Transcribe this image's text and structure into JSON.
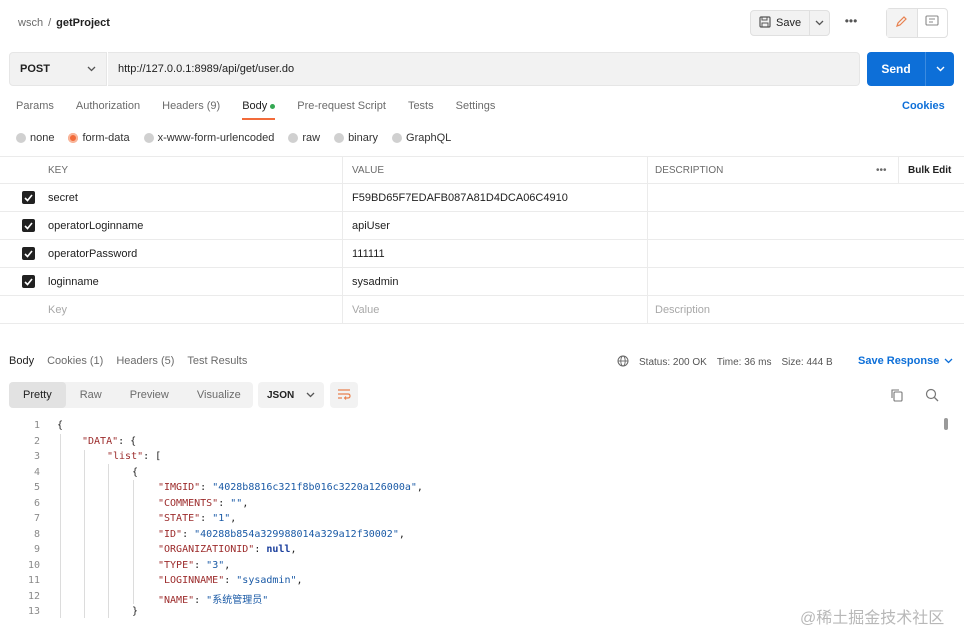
{
  "breadcrumb": {
    "workspace": "wsch",
    "separator": "/",
    "request": "getProject"
  },
  "toolbar": {
    "save_label": "Save",
    "more": "•••"
  },
  "request": {
    "method": "POST",
    "url": "http://127.0.0.1:8989/api/get/user.do",
    "send_label": "Send"
  },
  "tabs": {
    "params": "Params",
    "authorization": "Authorization",
    "headers": "Headers (9)",
    "body": "Body",
    "prerequest": "Pre-request Script",
    "tests": "Tests",
    "settings": "Settings",
    "cookies": "Cookies"
  },
  "body_types": {
    "none": "none",
    "form_data": "form-data",
    "urlencoded": "x-www-form-urlencoded",
    "raw": "raw",
    "binary": "binary",
    "graphql": "GraphQL"
  },
  "kv_table": {
    "headers": {
      "key": "KEY",
      "value": "VALUE",
      "description": "DESCRIPTION",
      "more": "•••",
      "bulk_edit": "Bulk Edit"
    },
    "rows": [
      {
        "key": "secret",
        "value": "F59BD65F7EDAFB087A81D4DCA06C4910"
      },
      {
        "key": "operatorLoginname",
        "value": "apiUser"
      },
      {
        "key": "operatorPassword",
        "value": "111111"
      },
      {
        "key": "loginname",
        "value": "sysadmin"
      }
    ],
    "placeholders": {
      "key": "Key",
      "value": "Value",
      "description": "Description"
    }
  },
  "response": {
    "tabs": {
      "body": "Body",
      "cookies": "Cookies (1)",
      "headers": "Headers (5)",
      "test_results": "Test Results"
    },
    "status": "Status: 200 OK",
    "time": "Time: 36 ms",
    "size": "Size: 444 B",
    "save_response": "Save Response",
    "views": {
      "pretty": "Pretty",
      "raw": "Raw",
      "preview": "Preview",
      "visualize": "Visualize"
    },
    "format": "JSON"
  },
  "code": {
    "line_numbers": [
      "1",
      "2",
      "3",
      "4",
      "5",
      "6",
      "7",
      "8",
      "9",
      "10",
      "11",
      "12",
      "13"
    ],
    "l1": "{",
    "l2_key": "\"DATA\"",
    "l2_rest": ": {",
    "l3_key": "\"list\"",
    "l3_rest": ": [",
    "l4": "{",
    "l5_key": "\"IMGID\"",
    "l5_val": "\"4028b8816c321f8b016c3220a126000a\"",
    "l6_key": "\"COMMENTS\"",
    "l6_val": "\"\"",
    "l7_key": "\"STATE\"",
    "l7_val": "\"1\"",
    "l8_key": "\"ID\"",
    "l8_val": "\"40288b854a329988014a329a12f30002\"",
    "l9_key": "\"ORGANIZATIONID\"",
    "l9_val": "null",
    "l10_key": "\"TYPE\"",
    "l10_val": "\"3\"",
    "l11_key": "\"LOGINNAME\"",
    "l11_val": "\"sysadmin\"",
    "l12_key": "\"NAME\"",
    "l12_val": "\"系统管理员\"",
    "l13": "}",
    "colon": ": ",
    "comma": ","
  },
  "watermark": "@稀土掘金技术社区"
}
